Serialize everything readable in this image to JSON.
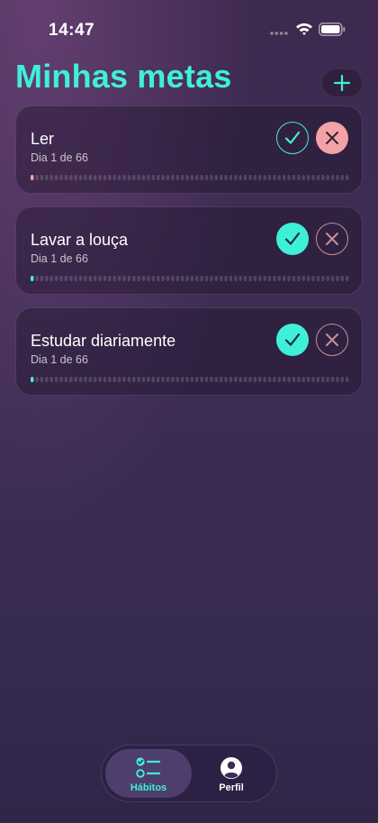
{
  "status_bar": {
    "time": "14:47"
  },
  "header": {
    "title": "Minhas metas"
  },
  "colors": {
    "accent": "#3ff0d8",
    "danger": "#f3a3a8",
    "danger_outline": "#c98f99"
  },
  "habits": [
    {
      "name": "Ler",
      "progress_text": "Dia 1 de 66",
      "current_day": 1,
      "total_days": 66,
      "check_state": "outline",
      "x_state": "filled",
      "day_marker_color": "#f3a3a8"
    },
    {
      "name": "Lavar a louça",
      "progress_text": "Dia 1 de 66",
      "current_day": 1,
      "total_days": 66,
      "check_state": "filled",
      "x_state": "outline",
      "day_marker_color": "#3ff0d8"
    },
    {
      "name": "Estudar diariamente",
      "progress_text": "Dia 1 de 66",
      "current_day": 1,
      "total_days": 66,
      "check_state": "filled",
      "x_state": "outline",
      "day_marker_color": "#3ff0d8"
    }
  ],
  "tab_bar": {
    "tabs": [
      {
        "label": "Hábitos",
        "icon": "checklist-icon",
        "active": true
      },
      {
        "label": "Perfil",
        "icon": "profile-icon",
        "active": false
      }
    ]
  }
}
